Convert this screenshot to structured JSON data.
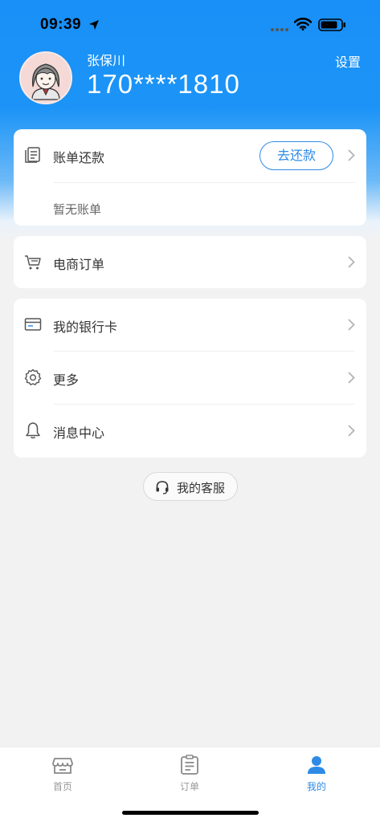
{
  "status_bar": {
    "time": "09:39"
  },
  "profile": {
    "name": "张保川",
    "phone": "170****1810",
    "settings_label": "设置"
  },
  "bill_card": {
    "title": "账单还款",
    "repay_button": "去还款",
    "empty_text": "暂无账单",
    "icon": "bill-icon"
  },
  "ecommerce": {
    "label": "电商订单",
    "icon": "cart-icon"
  },
  "menu": [
    {
      "label": "我的银行卡",
      "icon": "bank-card-icon"
    },
    {
      "label": "更多",
      "icon": "gear-icon"
    },
    {
      "label": "消息中心",
      "icon": "bell-icon"
    }
  ],
  "service_button": {
    "label": "我的客服",
    "icon": "headset-icon"
  },
  "tabbar": {
    "tabs": [
      {
        "label": "首页",
        "icon": "store-icon",
        "active": false
      },
      {
        "label": "订单",
        "icon": "clipboard-icon",
        "active": false
      },
      {
        "label": "我的",
        "icon": "person-icon",
        "active": true
      }
    ]
  },
  "colors": {
    "primary": "#1890f7",
    "accent_text": "#2d8be6",
    "background": "#f2f2f2"
  }
}
